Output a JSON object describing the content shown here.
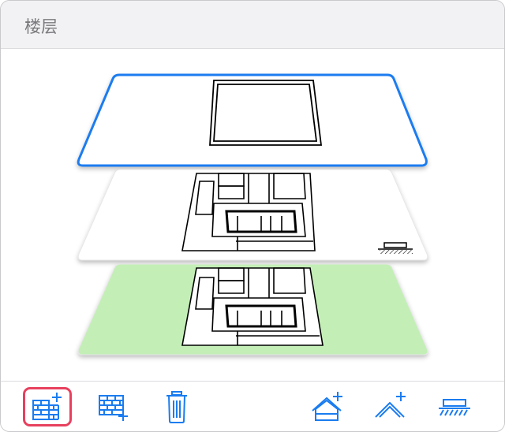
{
  "panel": {
    "title": "楼层"
  },
  "floors": [
    {
      "name": "top-floor",
      "state": "selected",
      "border_color": "#1a7cf0",
      "fill": "#ffffff"
    },
    {
      "name": "middle-floor",
      "state": "normal",
      "border_color": "#e6e6e6",
      "fill": "#ffffff"
    },
    {
      "name": "ground-floor",
      "state": "ground",
      "border_color": "#e6e6e6",
      "fill": "#c3efb6"
    }
  ],
  "toolbar": {
    "accent_color": "#1a7cf0",
    "selected_border_color": "#e8405e",
    "tools": [
      {
        "name": "add-floor-button",
        "icon": "brick-wall-plus-icon",
        "selected": true
      },
      {
        "name": "add-floor-below-button",
        "icon": "brick-wall-plus-below-icon",
        "selected": false
      },
      {
        "name": "delete-floor-button",
        "icon": "trash-icon",
        "selected": false
      },
      {
        "name": "add-roof-button",
        "icon": "house-plus-icon",
        "selected": false
      },
      {
        "name": "add-roof-outline-button",
        "icon": "roof-plus-icon",
        "selected": false
      },
      {
        "name": "ground-button",
        "icon": "ground-hatch-icon",
        "selected": false
      }
    ]
  }
}
